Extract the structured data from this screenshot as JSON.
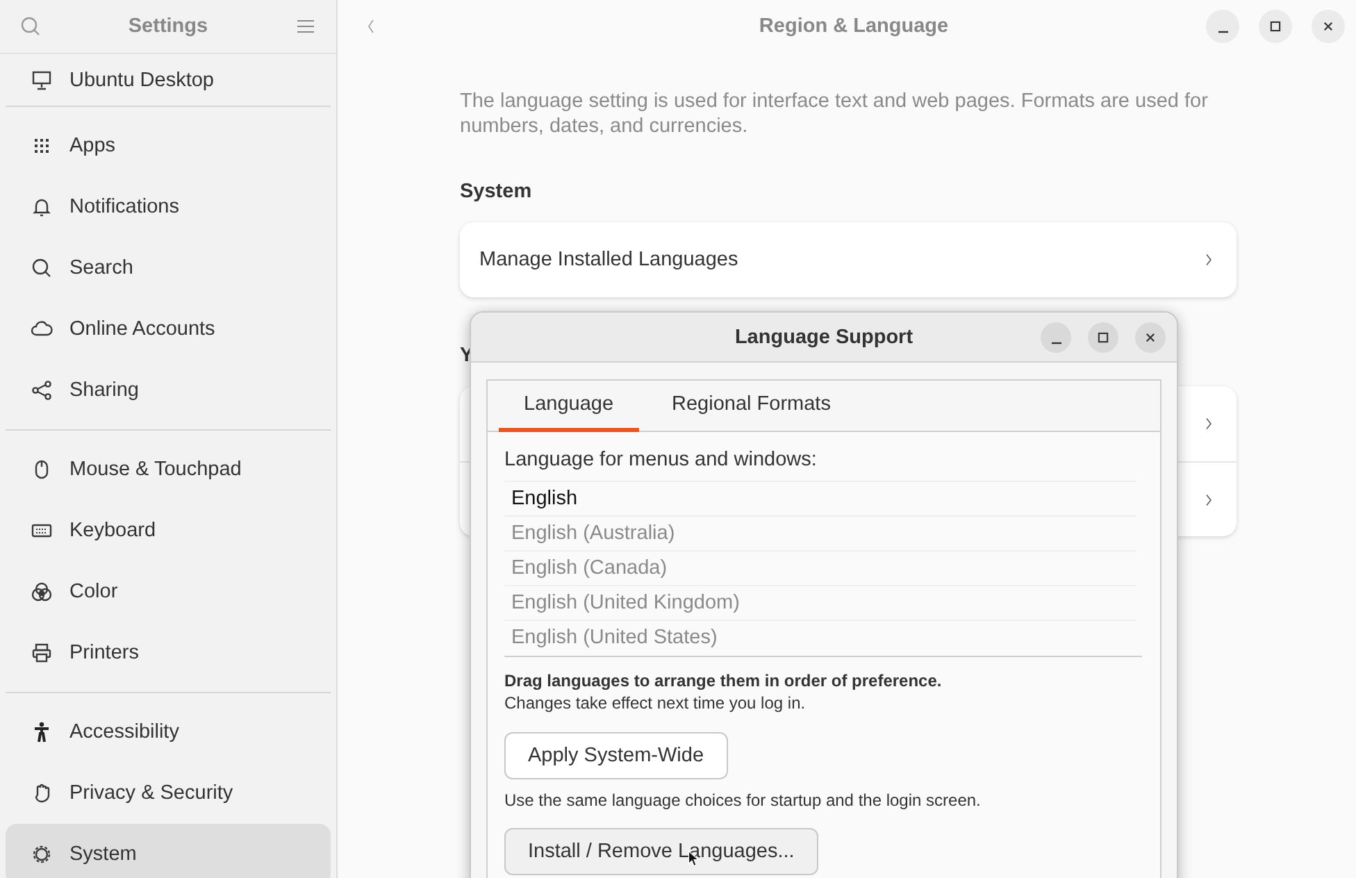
{
  "sidebar": {
    "title": "Settings",
    "groups": [
      {
        "items": [
          {
            "label": "Ubuntu Desktop",
            "selected": false
          }
        ]
      },
      {
        "items": [
          {
            "label": "Apps",
            "selected": false
          },
          {
            "label": "Notifications",
            "selected": false
          },
          {
            "label": "Search",
            "selected": false
          },
          {
            "label": "Online Accounts",
            "selected": false
          },
          {
            "label": "Sharing",
            "selected": false
          }
        ]
      },
      {
        "items": [
          {
            "label": "Mouse & Touchpad",
            "selected": false
          },
          {
            "label": "Keyboard",
            "selected": false
          },
          {
            "label": "Color",
            "selected": false
          },
          {
            "label": "Printers",
            "selected": false
          }
        ]
      },
      {
        "items": [
          {
            "label": "Accessibility",
            "selected": false
          },
          {
            "label": "Privacy & Security",
            "selected": false
          },
          {
            "label": "System",
            "selected": true
          }
        ]
      }
    ]
  },
  "page": {
    "title": "Region & Language",
    "description": "The language setting is used for interface text and web pages. Formats are used for numbers, dates, and currencies.",
    "sections": [
      {
        "heading": "System",
        "rows": [
          {
            "label": "Manage Installed Languages"
          }
        ]
      },
      {
        "heading": "Y",
        "rows": [
          {},
          {}
        ]
      }
    ]
  },
  "dialog": {
    "title": "Language Support",
    "tabs": [
      {
        "label": "Language",
        "selected": true
      },
      {
        "label": "Regional Formats",
        "selected": false
      }
    ],
    "list_label": "Language for menus and windows:",
    "languages": [
      {
        "name": "English",
        "active": true
      },
      {
        "name": "English (Australia)",
        "active": false
      },
      {
        "name": "English (Canada)",
        "active": false
      },
      {
        "name": "English (United Kingdom)",
        "active": false
      },
      {
        "name": "English (United States)",
        "active": false
      }
    ],
    "hint": "Drag languages to arrange them in order of preference.",
    "hint_note": "Changes take effect next time you log in.",
    "buttons": [
      {
        "label": "Apply System-Wide",
        "note": "Use the same language choices for startup and the login screen."
      },
      {
        "label": "Install / Remove Languages..."
      }
    ]
  }
}
